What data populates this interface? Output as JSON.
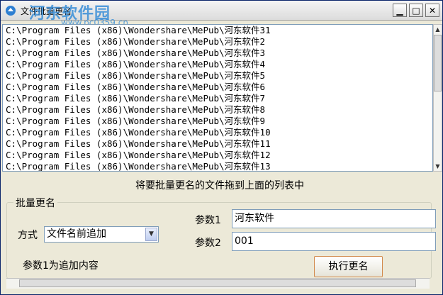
{
  "window": {
    "title": "文件批量更名",
    "watermark": "河东软件园",
    "watermark_url": "www.pc0359.cn",
    "minimize_glyph": "▁",
    "maximize_glyph": "□",
    "close_glyph": "✕"
  },
  "file_list": {
    "items": [
      "C:\\Program Files (x86)\\Wondershare\\MePub\\河东软件31",
      "C:\\Program Files (x86)\\Wondershare\\MePub\\河东软件2",
      "C:\\Program Files (x86)\\Wondershare\\MePub\\河东软件3",
      "C:\\Program Files (x86)\\Wondershare\\MePub\\河东软件4",
      "C:\\Program Files (x86)\\Wondershare\\MePub\\河东软件5",
      "C:\\Program Files (x86)\\Wondershare\\MePub\\河东软件6",
      "C:\\Program Files (x86)\\Wondershare\\MePub\\河东软件7",
      "C:\\Program Files (x86)\\Wondershare\\MePub\\河东软件8",
      "C:\\Program Files (x86)\\Wondershare\\MePub\\河东软件9",
      "C:\\Program Files (x86)\\Wondershare\\MePub\\河东软件10",
      "C:\\Program Files (x86)\\Wondershare\\MePub\\河东软件11",
      "C:\\Program Files (x86)\\Wondershare\\MePub\\河东软件12",
      "C:\\Program Files (x86)\\Wondershare\\MePub\\河东软件13"
    ]
  },
  "hint": "将要批量更名的文件拖到上面的列表中",
  "rename_group": {
    "title": "批量更名",
    "mode_label": "方式",
    "mode_value": "文件名前追加",
    "param1_label": "参数1",
    "param1_value": "河东软件",
    "param2_label": "参数2",
    "param2_value": "001",
    "param1_desc": "参数1为追加内容",
    "execute_label": "执行更名"
  },
  "icons": {
    "app": "app-icon",
    "dropdown": "chevron-down-icon"
  }
}
